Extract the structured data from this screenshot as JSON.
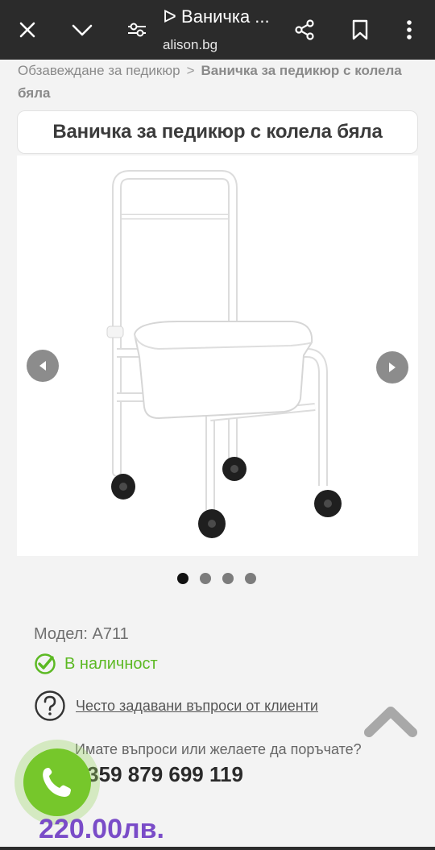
{
  "browser": {
    "tab_title": "ᐅ Ваничка ...",
    "url": "alison.bg",
    "icons": [
      "close-icon",
      "chevron-down-icon",
      "tune-icon",
      "share-icon",
      "bookmark-icon",
      "more-vert-icon"
    ]
  },
  "breadcrumb": {
    "parent": "Обзавеждане за педикюр",
    "separator": ">",
    "current": "Ваничка за педикюр с колела бяла"
  },
  "product": {
    "title": "Ваничка за педикюр с колела бяла",
    "model": "Модел: A711",
    "stock": "В наличност",
    "faq_link": "Често задавани въпроси от клиенти",
    "contact_question": "Имате въпроси или желаете да поръчате?",
    "phone": "+359 879 699 119",
    "price": "220.00лв."
  },
  "gallery": {
    "slide_count": 4,
    "active_slide": 1
  },
  "colors": {
    "topbar": "#2b2b2b",
    "stock_green": "#5cb923",
    "call_green": "#76c72b",
    "price_purple": "#7a4cc8"
  }
}
